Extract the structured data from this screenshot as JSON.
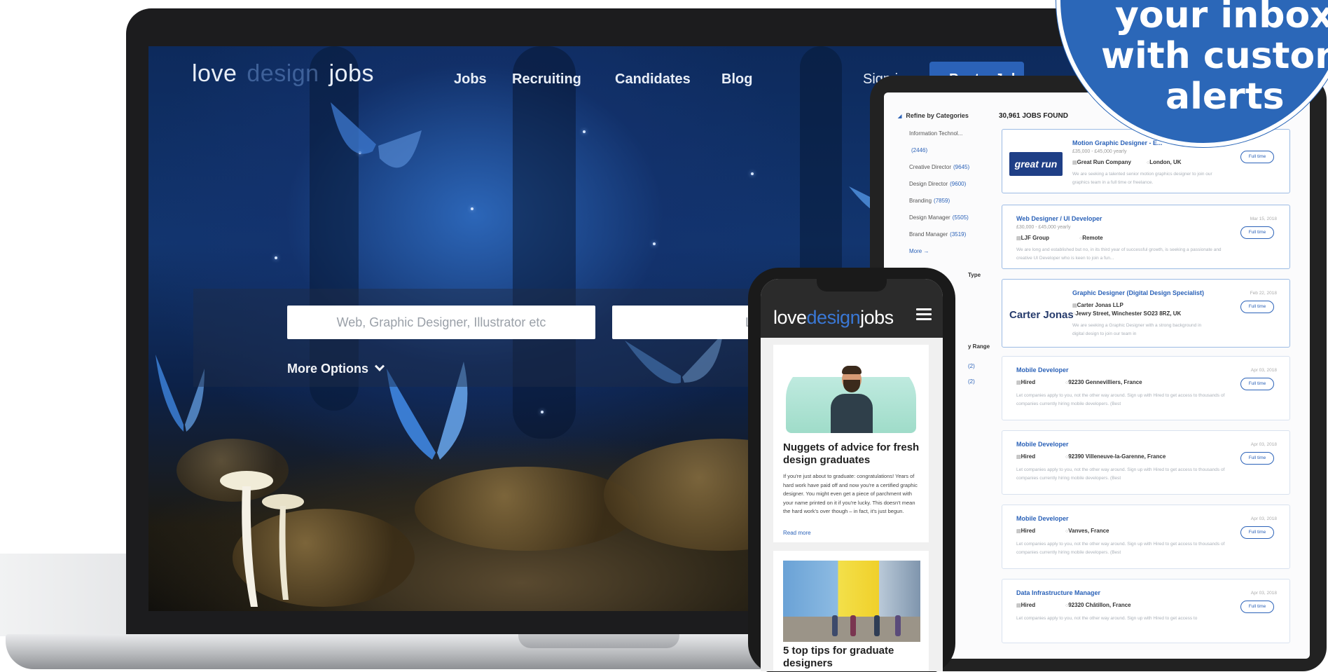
{
  "desktop": {
    "logo": {
      "love": "love",
      "design": "design",
      "jobs": "jobs"
    },
    "nav": [
      "Jobs",
      "Recruiting",
      "Candidates",
      "Blog"
    ],
    "sign_in": "Sign in",
    "post_job": "Post a Job",
    "search": {
      "keywords_placeholder": "Web, Graphic Designer, Illustrator etc",
      "location_placeholder": "Location"
    },
    "more_options": "More Options"
  },
  "tablet": {
    "refine_heading": "Refine by Categories",
    "categories": [
      {
        "label": "Information Technol...",
        "count": ""
      },
      {
        "label": "",
        "count": "(2446)"
      },
      {
        "label": "Creative Director",
        "count": "(9645)"
      },
      {
        "label": "Design Director",
        "count": "(9600)"
      },
      {
        "label": "Branding",
        "count": "(7859)"
      },
      {
        "label": "Design Manager",
        "count": "(5505)"
      },
      {
        "label": "Brand Manager",
        "count": "(3519)"
      }
    ],
    "more_categories": "More →",
    "refine_type": "Type",
    "refine_salary": "y Range",
    "side_links": [
      "(2)",
      "(2)"
    ],
    "jobs_found": "30,961 JOBS FOUND",
    "jobs": [
      {
        "title": "Motion Graphic Designer - E...",
        "salary": "£35,000 - £45,000 yearly",
        "company": "Great Run Company",
        "location": "London, UK",
        "desc": "We are seeking a talented senior motion graphics designer to join our graphics team in a full time or freelance.",
        "date": "",
        "type": "Full time",
        "logo": "great run",
        "featured": true
      },
      {
        "title": "Web Designer / UI Developer",
        "salary": "£30,000 - £45,000 yearly",
        "company": "LJF Group",
        "location": "Remote",
        "desc": "We are long and established but no, in its third year of successful growth, is seeking a passionate and creative UI Developer who is keen to join a fun...",
        "date": "Mar 15, 2018",
        "type": "Full time",
        "logo": "",
        "featured": true
      },
      {
        "title": "Graphic Designer (Digital Design Specialist)",
        "salary": "",
        "company": "Carter Jonas LLP",
        "location": "Jewry Street, Winchester SO23 8RZ, UK",
        "desc": "We are seeking a Graphic Designer with a strong background in digital design to join our team in",
        "date": "Feb 22, 2018",
        "type": "Full time",
        "logo": "Carter Jonas",
        "featured": true
      },
      {
        "title": "Mobile Developer",
        "salary": "",
        "company": "Hired",
        "location": "92230 Gennevilliers, France",
        "desc": "Let companies apply to you, not the other way around. Sign up with Hired to get access to thousands of companies currently hiring mobile developers. (Best",
        "date": "Apr 03, 2018",
        "type": "Full time",
        "logo": "",
        "featured": false
      },
      {
        "title": "Mobile Developer",
        "salary": "",
        "company": "Hired",
        "location": "92390 Villeneuve-la-Garenne, France",
        "desc": "Let companies apply to you, not the other way around. Sign up with Hired to get access to thousands of companies currently hiring mobile developers. (Best",
        "date": "Apr 03, 2018",
        "type": "Full time",
        "logo": "",
        "featured": false
      },
      {
        "title": "Mobile Developer",
        "salary": "",
        "company": "Hired",
        "location": "Vanves, France",
        "desc": "Let companies apply to you, not the other way around. Sign up with Hired to get access to thousands of companies currently hiring mobile developers. (Best",
        "date": "Apr 03, 2018",
        "type": "Full time",
        "logo": "",
        "featured": false
      },
      {
        "title": "Data Infrastructure Manager",
        "salary": "",
        "company": "Hired",
        "location": "92320 Châtillon, France",
        "desc": "Let companies apply to you, not the other way around. Sign up with Hired to get access to",
        "date": "Apr 03, 2018",
        "type": "Full time",
        "logo": "",
        "featured": false
      }
    ]
  },
  "phone": {
    "logo": {
      "love": "love",
      "design": "design",
      "jobs": "jobs"
    },
    "article1": {
      "title": "Nuggets of advice for fresh design graduates",
      "body": "If you're just about to graduate: congratulations! Years of hard work have paid off and now you're a certified graphic designer. You might even get a piece of parchment with your name printed on it if you're lucky. This doesn't mean the hard work's over though – in fact, it's just begun.",
      "read_more": "Read more"
    },
    "article2": {
      "title": "5 top tips for graduate designers"
    }
  },
  "badge": {
    "lines": [
      "your inbox",
      "with custom",
      "alerts"
    ]
  },
  "colors": {
    "brand_blue": "#2b62b8",
    "badge_blue": "#2b67b8",
    "dark": "#1c1c1e"
  }
}
